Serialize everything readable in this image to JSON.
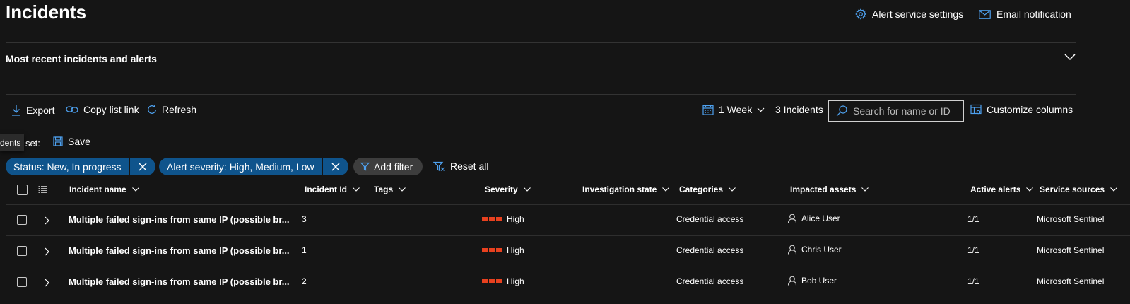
{
  "page": {
    "title": "Incidents"
  },
  "header_actions": {
    "alert_settings": "Alert service settings",
    "email_notification": "Email notification"
  },
  "recent": {
    "title": "Most recent incidents and alerts"
  },
  "toolbar": {
    "export": "Export",
    "copy_link": "Copy list link",
    "refresh": "Refresh",
    "range": "1 Week",
    "count": "3 Incidents",
    "search_placeholder": "Search for name or ID",
    "customize": "Customize columns"
  },
  "filterset": {
    "label": "r set:",
    "save": "Save",
    "tooltip": "dents"
  },
  "filters": {
    "status": "Status: New, In progress",
    "severity": "Alert severity: High, Medium, Low",
    "add": "Add filter",
    "reset": "Reset all"
  },
  "columns": {
    "name": "Incident name",
    "id": "Incident Id",
    "tags": "Tags",
    "severity": "Severity",
    "investigation": "Investigation state",
    "categories": "Categories",
    "assets": "Impacted assets",
    "active": "Active alerts",
    "sources": "Service sources"
  },
  "rows": [
    {
      "name": "Multiple failed sign-ins from same IP (possible br...",
      "id": "3",
      "severity": "High",
      "category": "Credential access",
      "asset": "Alice User",
      "active": "1/1",
      "source": "Microsoft Sentinel"
    },
    {
      "name": "Multiple failed sign-ins from same IP (possible br...",
      "id": "1",
      "severity": "High",
      "category": "Credential access",
      "asset": "Chris User",
      "active": "1/1",
      "source": "Microsoft Sentinel"
    },
    {
      "name": "Multiple failed sign-ins from same IP (possible br...",
      "id": "2",
      "severity": "High",
      "category": "Credential access",
      "asset": "Bob User",
      "active": "1/1",
      "source": "Microsoft Sentinel"
    }
  ],
  "colors": {
    "accent": "#4ea1ef",
    "pill": "#0f548c",
    "severity_high": "#e8411f",
    "background": "#151515"
  }
}
